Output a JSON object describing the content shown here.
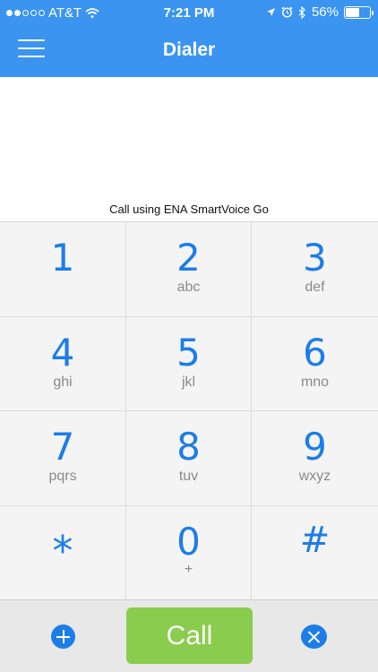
{
  "status_bar": {
    "carrier": "AT&T",
    "time": "7:21 PM",
    "battery": "56%",
    "battery_level": 0.56,
    "signal_bars_filled": 2,
    "signal_bars_total": 5
  },
  "header": {
    "title": "Dialer",
    "menu_icon": "hamburger-menu-icon"
  },
  "dialer": {
    "call_using": "Call using ENA SmartVoice Go",
    "keys": [
      {
        "digit": "1",
        "letters": ""
      },
      {
        "digit": "2",
        "letters": "abc"
      },
      {
        "digit": "3",
        "letters": "def"
      },
      {
        "digit": "4",
        "letters": "ghi"
      },
      {
        "digit": "5",
        "letters": "jkl"
      },
      {
        "digit": "6",
        "letters": "mno"
      },
      {
        "digit": "7",
        "letters": "pqrs"
      },
      {
        "digit": "8",
        "letters": "tuv"
      },
      {
        "digit": "9",
        "letters": "wxyz"
      },
      {
        "digit": "*",
        "letters": ""
      },
      {
        "digit": "0",
        "letters": "+"
      },
      {
        "digit": "#",
        "letters": ""
      }
    ]
  },
  "bottom_bar": {
    "add_icon": "plus-circle-icon",
    "call_label": "Call",
    "delete_icon": "delete-icon"
  },
  "colors": {
    "header_bg": "#3a94f0",
    "key_digit": "#1c7de8",
    "call_button": "#8acc4e"
  }
}
